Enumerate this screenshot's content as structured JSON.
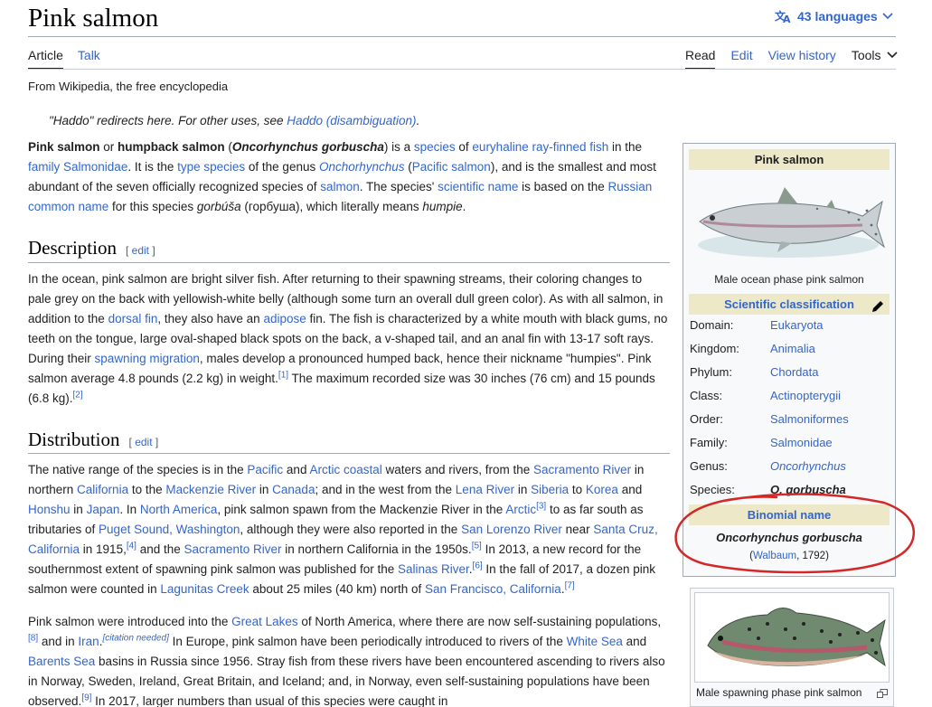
{
  "title": "Pink salmon",
  "languages": "43 languages",
  "tabs_left": [
    "Article",
    "Talk"
  ],
  "tabs_right": [
    "Read",
    "Edit",
    "View history",
    "Tools"
  ],
  "tagline": "From Wikipedia, the free encyclopedia",
  "hatnote": {
    "prefix": "\"Haddo\" redirects here. For other uses, see ",
    "link": "Haddo (disambiguation)",
    "suffix": "."
  },
  "sections": {
    "description": "Description",
    "distribution": "Distribution",
    "edit": "edit"
  },
  "infobox": {
    "title": "Pink salmon",
    "image_caption": "Male ocean phase pink salmon",
    "sci_header": "Scientific classification",
    "rows": [
      {
        "label": "Domain:",
        "value": "Eukaryota"
      },
      {
        "label": "Kingdom:",
        "value": "Animalia"
      },
      {
        "label": "Phylum:",
        "value": "Chordata"
      },
      {
        "label": "Class:",
        "value": "Actinopterygii"
      },
      {
        "label": "Order:",
        "value": "Salmoniformes"
      },
      {
        "label": "Family:",
        "value": "Salmonidae"
      },
      {
        "label": "Genus:",
        "value": "Oncorhynchus"
      },
      {
        "label": "Species:",
        "value": "O. gorbuscha"
      }
    ],
    "binomial_header": "Binomial name",
    "binomial": "Oncorhynchus gorbuscha",
    "authority_open": "(",
    "authority_link": "Walbaum",
    "authority_year": ", 1792)"
  },
  "thumb2_caption": "Male spawning phase pink salmon",
  "intro": [
    {
      "t": "Pink salmon",
      "b": 1
    },
    {
      "t": " or "
    },
    {
      "t": "humpback salmon",
      "b": 1
    },
    {
      "t": " ("
    },
    {
      "t": "Oncorhynchus gorbuscha",
      "b": 1,
      "i": 1
    },
    {
      "t": ") is a "
    },
    {
      "t": "species",
      "l": 1
    },
    {
      "t": " of "
    },
    {
      "t": "euryhaline",
      "l": 1
    },
    {
      "t": " "
    },
    {
      "t": "ray-finned fish",
      "l": 1
    },
    {
      "t": " in the "
    },
    {
      "t": "family",
      "l": 1
    },
    {
      "t": " "
    },
    {
      "t": "Salmonidae",
      "l": 1
    },
    {
      "t": ". It is the "
    },
    {
      "t": "type species",
      "l": 1
    },
    {
      "t": " of the genus "
    },
    {
      "t": "Onchorhynchus",
      "l": 1,
      "i": 1
    },
    {
      "t": " ("
    },
    {
      "t": "Pacific salmon",
      "l": 1
    },
    {
      "t": "), and is the smallest and most abundant of the seven officially recognized species of "
    },
    {
      "t": "salmon",
      "l": 1
    },
    {
      "t": ". The species' "
    },
    {
      "t": "scientific name",
      "l": 1
    },
    {
      "t": " is based on the "
    },
    {
      "t": "Russian",
      "l": 1
    },
    {
      "t": " "
    },
    {
      "t": "common name",
      "l": 1
    },
    {
      "t": " for this species "
    },
    {
      "t": "gorbúša",
      "i": 1
    },
    {
      "t": " (горбуша), which literally means "
    },
    {
      "t": "humpie",
      "i": 1
    },
    {
      "t": "."
    }
  ],
  "description_para": [
    {
      "t": "In the ocean, pink salmon are bright silver fish. After returning to their spawning streams, their coloring changes to pale grey on the back with yellowish-white belly (although some turn an overall dull green color). As with all salmon, in addition to the "
    },
    {
      "t": "dorsal fin",
      "l": 1
    },
    {
      "t": ", they also have an "
    },
    {
      "t": "adipose",
      "l": 1
    },
    {
      "t": " fin. The fish is characterized by a white mouth with black gums, no teeth on the tongue, large oval-shaped black spots on the back, a v-shaped tail, and an anal fin with 13-17 soft rays. During their "
    },
    {
      "t": "spawning migration",
      "l": 1
    },
    {
      "t": ", males develop a pronounced humped back, hence their nickname \"humpies\". Pink salmon average 4.8 pounds (2.2 kg) in weight."
    },
    {
      "t": "[1]",
      "s": 1
    },
    {
      "t": " The maximum recorded size was 30 inches (76 cm) and 15 pounds (6.8 kg)."
    },
    {
      "t": "[2]",
      "s": 1
    }
  ],
  "distribution_para1": [
    {
      "t": "The native range of the species is in the "
    },
    {
      "t": "Pacific",
      "l": 1
    },
    {
      "t": " and "
    },
    {
      "t": "Arctic coastal",
      "l": 1
    },
    {
      "t": " waters and rivers, from the "
    },
    {
      "t": "Sacramento River",
      "l": 1
    },
    {
      "t": " in northern "
    },
    {
      "t": "California",
      "l": 1
    },
    {
      "t": " to the "
    },
    {
      "t": "Mackenzie River",
      "l": 1
    },
    {
      "t": " in "
    },
    {
      "t": "Canada",
      "l": 1
    },
    {
      "t": "; and in the west from the "
    },
    {
      "t": "Lena River",
      "l": 1
    },
    {
      "t": " in "
    },
    {
      "t": "Siberia",
      "l": 1
    },
    {
      "t": " to "
    },
    {
      "t": "Korea",
      "l": 1
    },
    {
      "t": " and "
    },
    {
      "t": "Honshu",
      "l": 1
    },
    {
      "t": " in "
    },
    {
      "t": "Japan",
      "l": 1
    },
    {
      "t": ". In "
    },
    {
      "t": "North America",
      "l": 1
    },
    {
      "t": ", pink salmon spawn from the Mackenzie River in the "
    },
    {
      "t": "Arctic",
      "l": 1
    },
    {
      "t": "[3]",
      "s": 1
    },
    {
      "t": " to as far south as tributaries of "
    },
    {
      "t": "Puget Sound, Washington",
      "l": 1
    },
    {
      "t": ", although they were also reported in the "
    },
    {
      "t": "San Lorenzo River",
      "l": 1
    },
    {
      "t": " near "
    },
    {
      "t": "Santa Cruz, California",
      "l": 1
    },
    {
      "t": " in 1915,"
    },
    {
      "t": "[4]",
      "s": 1
    },
    {
      "t": " and the "
    },
    {
      "t": "Sacramento River",
      "l": 1
    },
    {
      "t": " in northern California in the 1950s."
    },
    {
      "t": "[5]",
      "s": 1
    },
    {
      "t": " In 2013, a new record for the southernmost extent of spawning pink salmon was published for the "
    },
    {
      "t": "Salinas River",
      "l": 1
    },
    {
      "t": "."
    },
    {
      "t": "[6]",
      "s": 1
    },
    {
      "t": " In the fall of 2017, a dozen pink salmon were counted in "
    },
    {
      "t": "Lagunitas Creek",
      "l": 1
    },
    {
      "t": " about 25 miles (40 km) north of "
    },
    {
      "t": "San Francisco, California",
      "l": 1
    },
    {
      "t": "."
    },
    {
      "t": "[7]",
      "s": 1
    }
  ],
  "distribution_para2": [
    {
      "t": "Pink salmon were introduced into the "
    },
    {
      "t": "Great Lakes",
      "l": 1
    },
    {
      "t": " of North America, where there are now self-sustaining populations,"
    },
    {
      "t": "[8]",
      "s": 1
    },
    {
      "t": " and in "
    },
    {
      "t": "Iran",
      "l": 1
    },
    {
      "t": ".",
      "s": 0
    },
    {
      "t": "[citation needed]",
      "s": 1,
      "i": 1
    },
    {
      "t": " In Europe, pink salmon have been periodically introduced to rivers of the "
    },
    {
      "t": "White Sea",
      "l": 1
    },
    {
      "t": " and "
    },
    {
      "t": "Barents Sea",
      "l": 1
    },
    {
      "t": " basins in Russia since 1956. Stray fish from these rivers have been encountered ascending to rivers also in Norway, Sweden, Ireland, Great Britain, and Iceland; and, in Norway, even self-sustaining populations have been observed."
    },
    {
      "t": "[9]",
      "s": 1
    },
    {
      "t": " In 2017, larger numbers than usual of this species were caught in"
    }
  ]
}
